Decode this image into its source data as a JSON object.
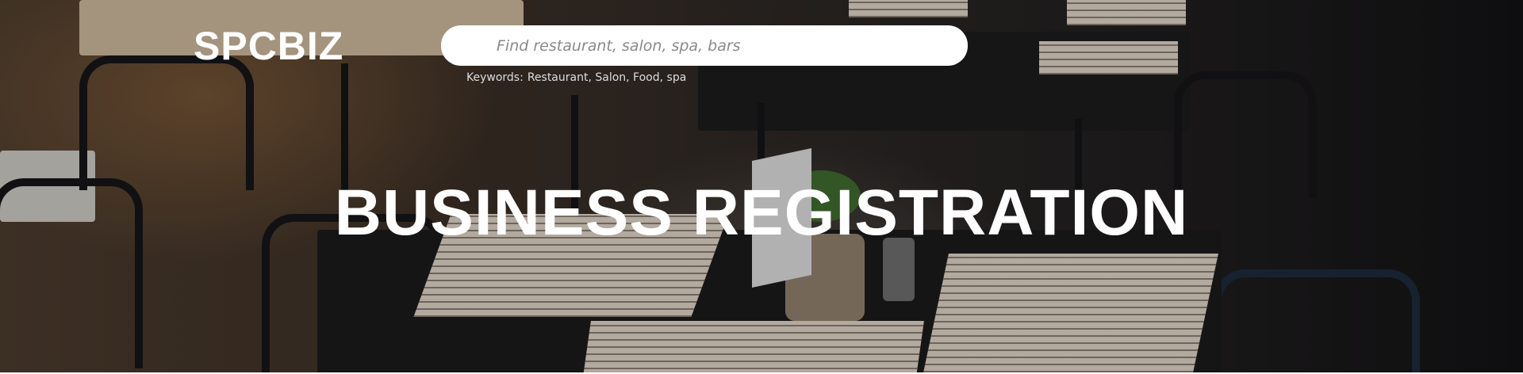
{
  "brand": {
    "logo_text": "SPCBIZ"
  },
  "search": {
    "placeholder": "Find restaurant, salon, spa, bars",
    "value": ""
  },
  "keywords": {
    "label": "Keywords:",
    "items": "Restaurant, Salon, Food, spa"
  },
  "hero": {
    "title": "BUSINESS REGISTRATION"
  },
  "colors": {
    "overlay_text": "#ffffff",
    "search_bg": "#ffffff",
    "placeholder": "#8a8a8a"
  },
  "icons": {
    "hero_background": "restaurant-photo"
  }
}
